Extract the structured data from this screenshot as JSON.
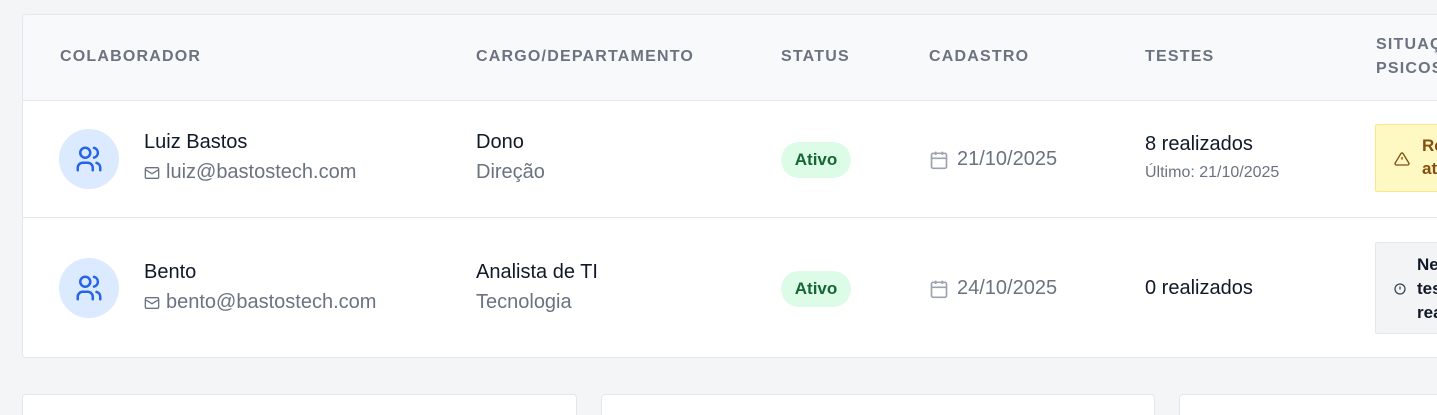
{
  "headers": {
    "colaborador": "COLABORADOR",
    "cargo": "CARGO/DEPARTAMENTO",
    "status": "STATUS",
    "cadastro": "CADASTRO",
    "testes": "TESTES",
    "situacao_l1": "SITUAÇ",
    "situacao_l2": "PSICOS"
  },
  "rows": [
    {
      "name": "Luiz Bastos",
      "email": "luiz@bastostech.com",
      "cargo": "Dono",
      "departamento": "Direção",
      "status": "Ativo",
      "cadastro": "21/10/2025",
      "testes": "8 realizados",
      "ultimo": "Último: 21/10/2025",
      "situacao": [
        "Re",
        "at"
      ]
    },
    {
      "name": "Bento",
      "email": "bento@bastostech.com",
      "cargo": "Analista de TI",
      "departamento": "Tecnologia",
      "status": "Ativo",
      "cadastro": "24/10/2025",
      "testes": "0 realizados",
      "situacao": [
        "Ne",
        "tes",
        "rea"
      ]
    }
  ],
  "colors": {
    "warn_bg": "#fef9c3",
    "warn_text": "#854d0e",
    "neutral_bg": "#f3f4f6",
    "active_bg": "#dcfce7",
    "active_text": "#166534",
    "accent": "#2563eb"
  }
}
